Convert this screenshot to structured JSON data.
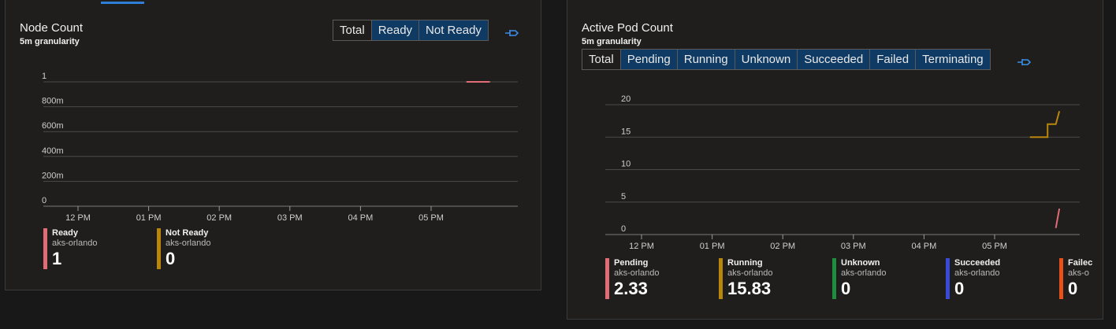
{
  "colors": {
    "pending": "#e06c75",
    "running": "#b8860b",
    "unknown": "#1e8e3e",
    "succeeded": "#3a4ad8",
    "failed": "#e8501a",
    "accent": "#2f7ed8"
  },
  "node_panel": {
    "title": "Node Count",
    "subtitle": "5m granularity",
    "tabs": [
      "Total",
      "Ready",
      "Not Ready"
    ],
    "active_tab": "Total",
    "pin_icon": "pin-icon",
    "legend": [
      {
        "name": "Ready",
        "cluster": "aks-orlando",
        "value": "1",
        "color": "#e06c75"
      },
      {
        "name": "Not Ready",
        "cluster": "aks-orlando",
        "value": "0",
        "color": "#b8860b"
      }
    ]
  },
  "pod_panel": {
    "title": "Active Pod Count",
    "subtitle": "5m granularity",
    "tabs": [
      "Total",
      "Pending",
      "Running",
      "Unknown",
      "Succeeded",
      "Failed",
      "Terminating"
    ],
    "active_tab": "Total",
    "pin_icon": "pin-icon",
    "legend": [
      {
        "name": "Pending",
        "cluster": "aks-orlando",
        "value": "2.33",
        "color": "#e06c75"
      },
      {
        "name": "Running",
        "cluster": "aks-orlando",
        "value": "15.83",
        "color": "#b8860b"
      },
      {
        "name": "Unknown",
        "cluster": "aks-orlando",
        "value": "0",
        "color": "#1e8e3e"
      },
      {
        "name": "Succeeded",
        "cluster": "aks-orlando",
        "value": "0",
        "color": "#3a4ad8"
      },
      {
        "name": "Failec",
        "cluster": "aks-o",
        "value": "0",
        "color": "#e8501a"
      }
    ]
  },
  "chart_data": [
    {
      "type": "line",
      "title": "Node Count",
      "xlabel": "",
      "ylabel": "",
      "x_ticks": [
        "12 PM",
        "01 PM",
        "02 PM",
        "03 PM",
        "04 PM",
        "05 PM"
      ],
      "y_ticks": [
        "0",
        "200m",
        "400m",
        "600m",
        "800m",
        "1"
      ],
      "ylim": [
        0,
        1
      ],
      "series": [
        {
          "name": "Ready",
          "color": "#e06c75",
          "x": [
            "05:30 PM",
            "05:50 PM"
          ],
          "values": [
            1,
            1
          ]
        }
      ]
    },
    {
      "type": "line",
      "title": "Active Pod Count",
      "xlabel": "",
      "ylabel": "",
      "x_ticks": [
        "12 PM",
        "01 PM",
        "02 PM",
        "03 PM",
        "04 PM",
        "05 PM"
      ],
      "y_ticks": [
        "0",
        "5",
        "10",
        "15",
        "20"
      ],
      "ylim": [
        0,
        20
      ],
      "series": [
        {
          "name": "Running",
          "color": "#b8860b",
          "x": [
            "05:30 PM",
            "05:45 PM",
            "05:45 PM",
            "05:52 PM",
            "05:52 PM",
            "05:55 PM"
          ],
          "values": [
            15,
            15,
            17,
            17,
            17,
            19
          ]
        },
        {
          "name": "Pending",
          "color": "#e06c75",
          "x": [
            "05:52 PM",
            "05:55 PM"
          ],
          "values": [
            1,
            4
          ]
        }
      ]
    }
  ]
}
